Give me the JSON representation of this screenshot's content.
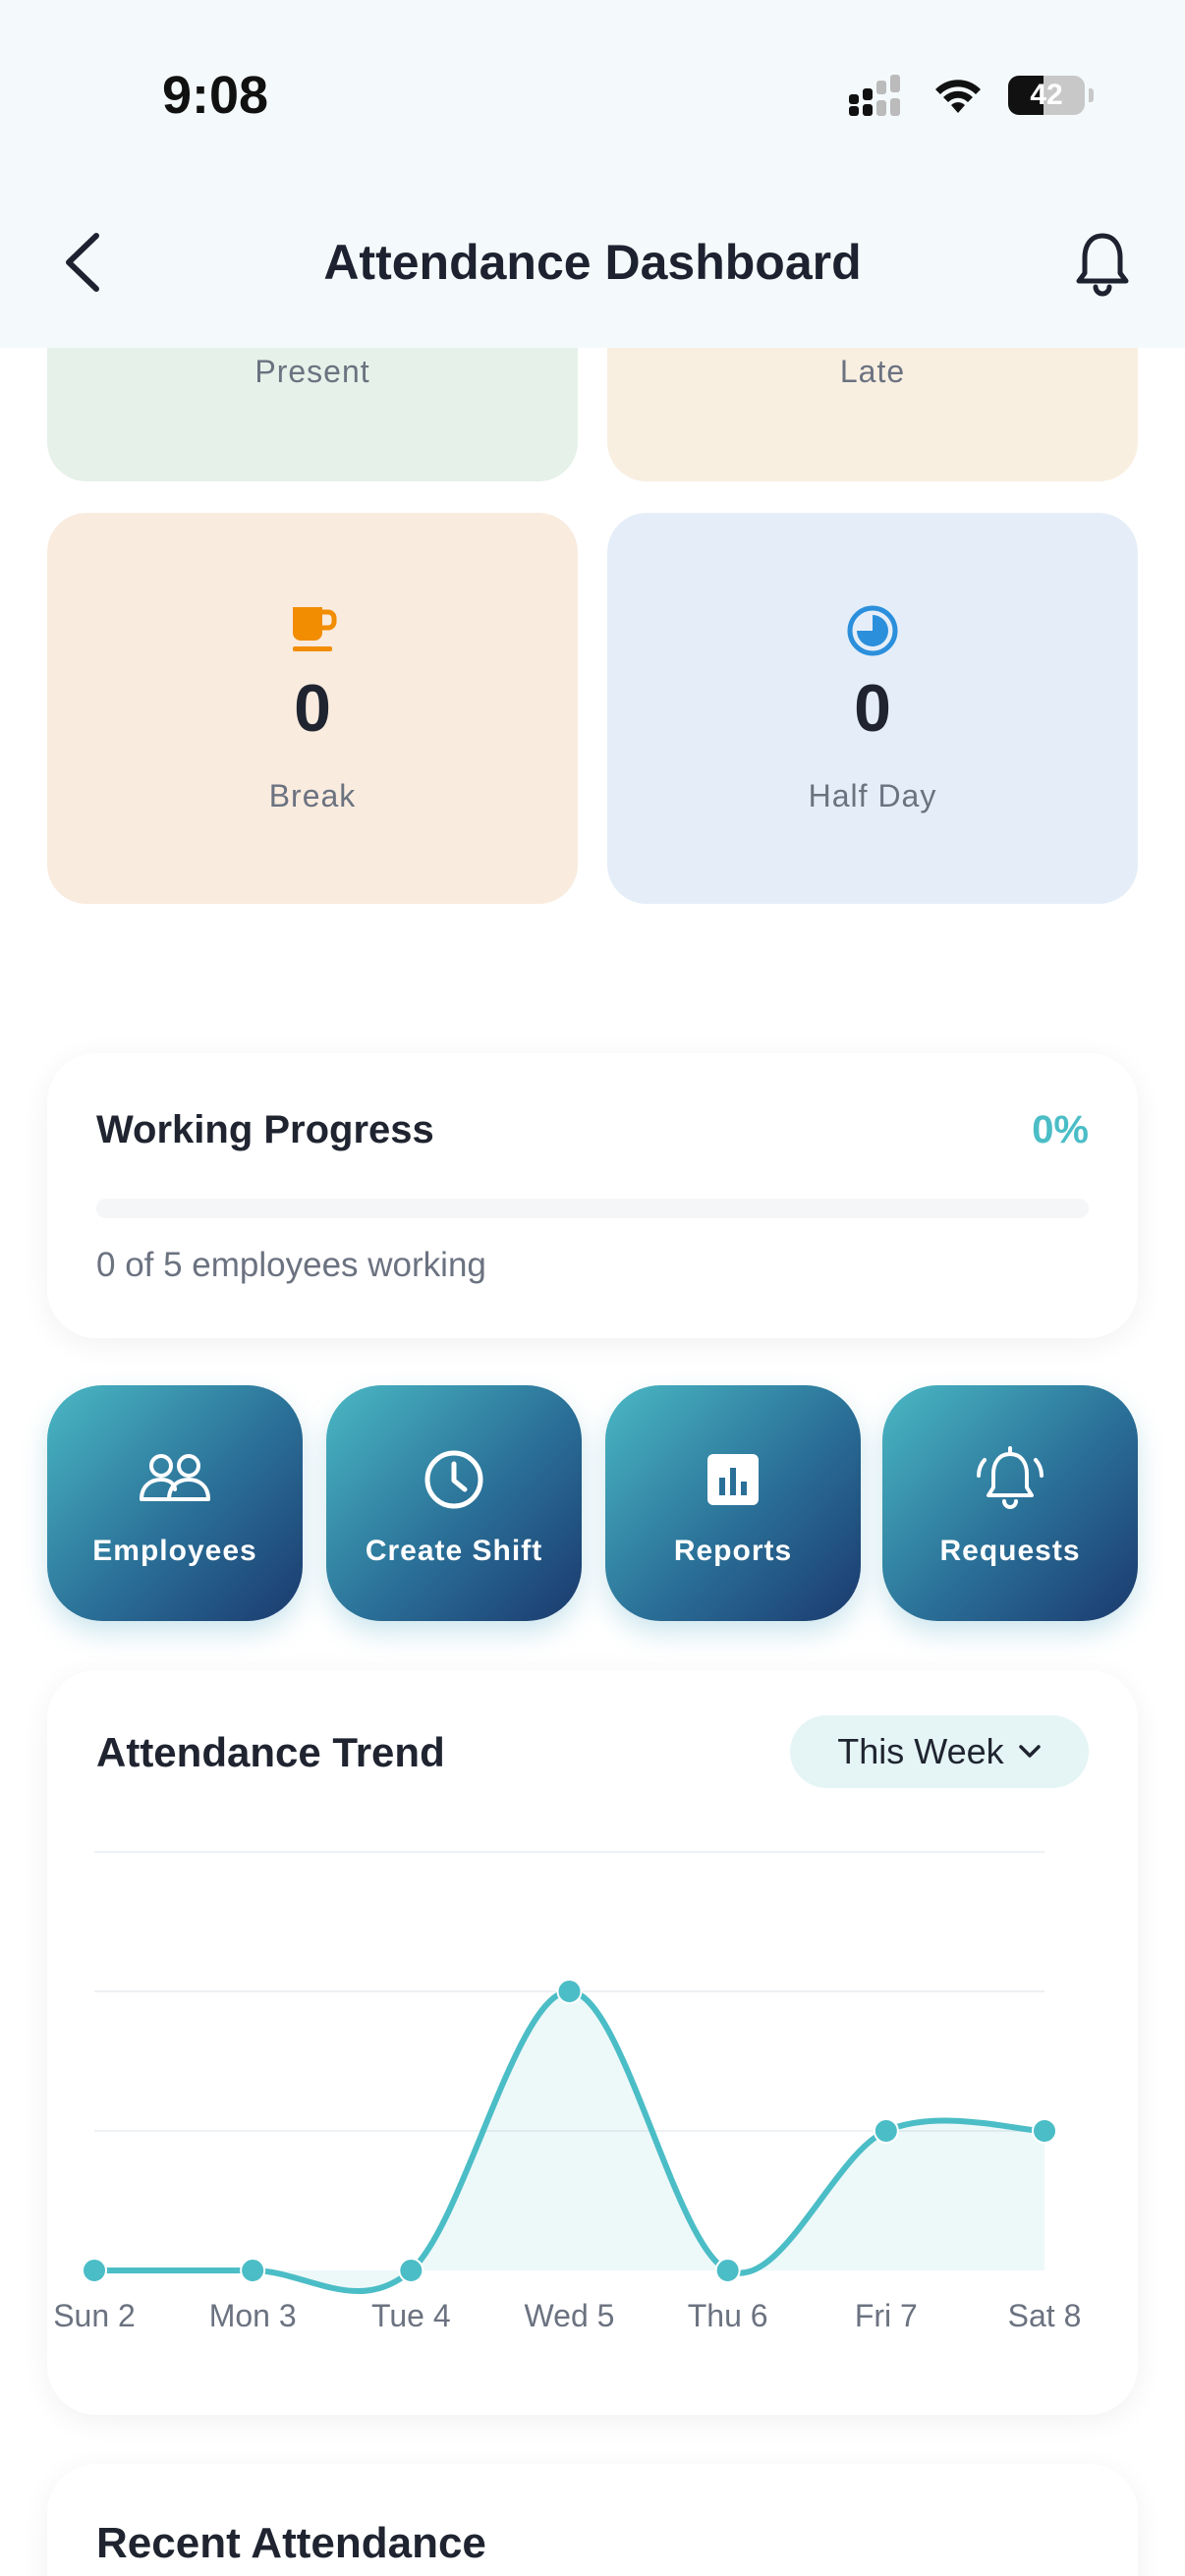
{
  "status_bar": {
    "time": "9:08",
    "battery": "42"
  },
  "header": {
    "title": "Attendance Dashboard",
    "back_icon": "chevron-left-icon",
    "bell_icon": "bell-icon"
  },
  "stats": {
    "present": {
      "label": "Present"
    },
    "late": {
      "label": "Late"
    },
    "break": {
      "value": "0",
      "label": "Break",
      "icon": "coffee-cup-icon",
      "color": "#f28c00",
      "bg": "#f9ebde"
    },
    "half_day": {
      "value": "0",
      "label": "Half Day",
      "icon": "half-clock-icon",
      "color": "#2b8fdc",
      "bg": "#e5eef8"
    }
  },
  "progress": {
    "title": "Working Progress",
    "percent_text": "0%",
    "percent": 0,
    "subtitle": "0 of 5 employees working",
    "accent": "#4bbdc6"
  },
  "actions": [
    {
      "label": "Employees",
      "icon": "users-icon"
    },
    {
      "label": "Create Shift",
      "icon": "clock-icon"
    },
    {
      "label": "Reports",
      "icon": "bar-chart-icon"
    },
    {
      "label": "Requests",
      "icon": "alarm-bell-icon"
    }
  ],
  "trend": {
    "title": "Attendance Trend",
    "range_label": "This Week",
    "range_icon": "chevron-down-icon"
  },
  "chart_data": {
    "type": "area",
    "categories": [
      "Sun 2",
      "Mon 3",
      "Tue 4",
      "Wed 5",
      "Thu 6",
      "Fri 7",
      "Sat 8"
    ],
    "values": [
      0,
      0,
      0,
      2,
      0,
      1,
      1
    ],
    "ylim": [
      0,
      3
    ],
    "grid": true,
    "color": "#4bbdc6"
  },
  "recent": {
    "title": "Recent Attendance"
  }
}
